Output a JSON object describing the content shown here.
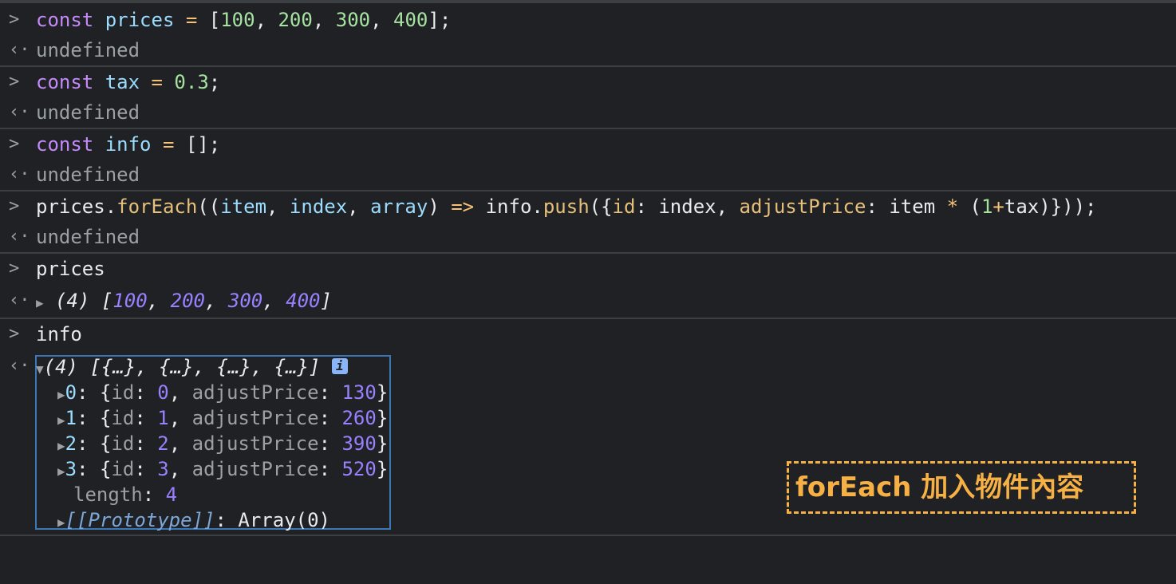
{
  "entries": [
    {
      "input": [
        "const",
        "prices",
        "=",
        "[",
        "100",
        ",",
        "200",
        ",",
        "300",
        ",",
        "400",
        "];"
      ],
      "output": "undefined"
    },
    {
      "input": [
        "const",
        "tax",
        "=",
        "0.3",
        ";"
      ],
      "output": "undefined"
    },
    {
      "input": [
        "const",
        "info",
        "=",
        "[];"
      ],
      "output": "undefined"
    }
  ],
  "foreach_line": {
    "p1": "prices.",
    "fn": "forEach",
    "p2": "((",
    "a1": "item",
    "c1": ", ",
    "a2": "index",
    "c2": ", ",
    "a3": "array",
    "p3": ") ",
    "arrow": "=>",
    "p4": " info.",
    "push": "push",
    "p5": "({",
    "k1": "id",
    "p6": ": index, ",
    "k2": "adjustPrice",
    "p7": ": item ",
    "mul": "*",
    "p8": " (",
    "one": "1",
    "plus": "+",
    "p9": "tax)}));",
    "output": "undefined"
  },
  "prices_eval": {
    "input": "prices",
    "count": "(4)",
    "values": [
      "100",
      "200",
      "300",
      "400"
    ]
  },
  "info_eval": {
    "input": "info",
    "summary": "(4) [{…}, {…}, {…}, {…}]",
    "badge": "i",
    "items": [
      {
        "index": "0",
        "id": "0",
        "adjustPrice": "130"
      },
      {
        "index": "1",
        "id": "1",
        "adjustPrice": "260"
      },
      {
        "index": "2",
        "id": "2",
        "adjustPrice": "390"
      },
      {
        "index": "3",
        "id": "3",
        "adjustPrice": "520"
      }
    ],
    "length_key": "length",
    "length_value": "4",
    "prototype_key": "[[Prototype]]",
    "prototype_value": "Array(0)"
  },
  "annotation": "forEach 加入物件內容",
  "colors": {
    "background": "#202124",
    "highlight_box": "#3d78b6",
    "annotation": "#f6b044"
  }
}
